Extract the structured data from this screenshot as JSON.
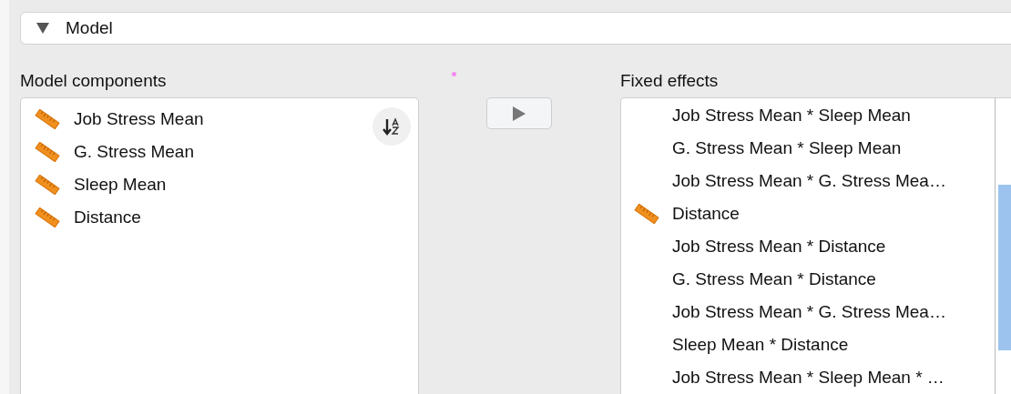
{
  "section": {
    "title": "Model",
    "expanded": true
  },
  "model_components": {
    "label": "Model components",
    "items": [
      {
        "kind": "scale",
        "label": "Job Stress Mean"
      },
      {
        "kind": "scale",
        "label": "G. Stress Mean"
      },
      {
        "kind": "scale",
        "label": "Sleep Mean"
      },
      {
        "kind": "scale",
        "label": "Distance"
      }
    ]
  },
  "fixed_effects": {
    "label": "Fixed effects",
    "items": [
      {
        "kind": "interaction",
        "label": "Job Stress Mean * Sleep Mean"
      },
      {
        "kind": "interaction",
        "label": "G. Stress Mean * Sleep Mean"
      },
      {
        "kind": "interaction",
        "label": "Job Stress Mean * G. Stress Mea…"
      },
      {
        "kind": "scale",
        "label": "Distance"
      },
      {
        "kind": "interaction",
        "label": "Job Stress Mean * Distance"
      },
      {
        "kind": "interaction",
        "label": "G. Stress Mean * Distance"
      },
      {
        "kind": "interaction",
        "label": "Job Stress Mean * G. Stress Mea…"
      },
      {
        "kind": "interaction",
        "label": "Sleep Mean * Distance"
      },
      {
        "kind": "interaction",
        "label": "Job Stress Mean * Sleep Mean * …"
      }
    ]
  }
}
